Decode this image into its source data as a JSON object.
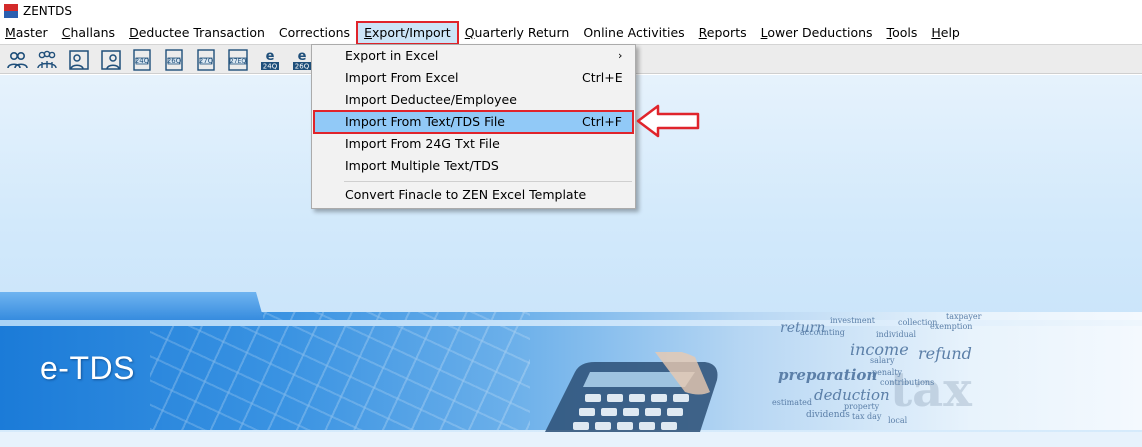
{
  "window": {
    "title": "ZENTDS",
    "logo_icon": "zen-logo-icon"
  },
  "menubar": {
    "items": [
      {
        "id": "master",
        "accel": "M",
        "rest": "aster",
        "active": false
      },
      {
        "id": "challans",
        "accel": "C",
        "rest": "hallans",
        "active": false
      },
      {
        "id": "deductee-transaction",
        "accel": "D",
        "rest": "eductee Transaction",
        "active": false
      },
      {
        "id": "corrections",
        "accel": "",
        "rest": "Corrections",
        "active": false
      },
      {
        "id": "export-import",
        "accel": "E",
        "rest": "xport/Import",
        "active": true
      },
      {
        "id": "quarterly-return",
        "accel": "Q",
        "rest": "uarterly Return",
        "active": false
      },
      {
        "id": "online-activities",
        "accel": "",
        "rest": "Online Activities",
        "active": false
      },
      {
        "id": "reports",
        "accel": "R",
        "rest": "eports",
        "active": false
      },
      {
        "id": "lower-deductions",
        "accel": "L",
        "rest": "ower Deductions",
        "active": false
      },
      {
        "id": "tools",
        "accel": "T",
        "rest": "ools",
        "active": false
      },
      {
        "id": "help",
        "accel": "H",
        "rest": "elp",
        "active": false
      }
    ]
  },
  "toolbar": {
    "buttons": [
      {
        "name": "deductor-icon",
        "label": ""
      },
      {
        "name": "deductees-group-icon",
        "label": ""
      },
      {
        "name": "employee-icon",
        "label": ""
      },
      {
        "name": "person-details-icon",
        "label": ""
      },
      {
        "name": "form-24q-icon",
        "label": "24Q"
      },
      {
        "name": "form-26q-icon",
        "label": "26Q"
      },
      {
        "name": "form-27q-icon",
        "label": "27Q"
      },
      {
        "name": "form-27eq-icon",
        "label": "27EQ"
      },
      {
        "name": "e-24q-icon",
        "label": "24Q"
      },
      {
        "name": "e-26q-icon",
        "label": "26Q"
      }
    ]
  },
  "export_import_menu": {
    "items": [
      {
        "label": "Export in Excel",
        "shortcut": "",
        "has_submenu": true,
        "submenu_glyph": "›",
        "highlighted": false
      },
      {
        "label": "Import From Excel",
        "shortcut": "Ctrl+E",
        "has_submenu": false,
        "highlighted": false
      },
      {
        "label": "Import Deductee/Employee",
        "shortcut": "",
        "has_submenu": false,
        "highlighted": false
      },
      {
        "label": "Import From Text/TDS File",
        "shortcut": "Ctrl+F",
        "has_submenu": false,
        "highlighted": true
      },
      {
        "label": "Import From 24G Txt File",
        "shortcut": "",
        "has_submenu": false,
        "highlighted": false
      },
      {
        "label": "Import Multiple Text/TDS",
        "shortcut": "",
        "has_submenu": false,
        "highlighted": false
      },
      {
        "label": "Convert Finacle to ZEN Excel Template",
        "shortcut": "",
        "has_submenu": false,
        "highlighted": false
      }
    ]
  },
  "banner": {
    "title": "e-TDS",
    "words": [
      "income",
      "refund",
      "preparation",
      "deduction",
      "tax",
      "return",
      "dividends",
      "salary",
      "penalty",
      "investment",
      "accounting",
      "property",
      "tax day",
      "exemption",
      "contributions",
      "estimated",
      "individual",
      "taxpayer",
      "collection",
      "local"
    ]
  },
  "colors": {
    "highlight": "#91c9f7",
    "annotation_red": "#e0242b",
    "menu_active": "#cce4f7"
  }
}
